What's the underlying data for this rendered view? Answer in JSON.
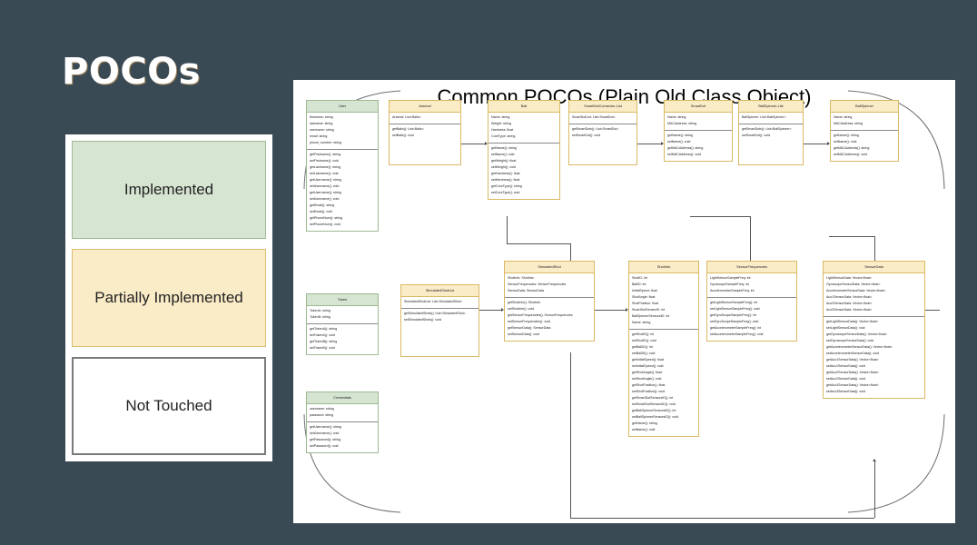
{
  "slide": {
    "title": "POCOs",
    "background_color": "#3a4a55"
  },
  "legend": {
    "items": [
      {
        "label": "Implemented",
        "color": "#d6e4d2",
        "border": "#9dba93"
      },
      {
        "label": "Partially Implemented",
        "color": "#fbecc8",
        "border": "#d9bd72"
      },
      {
        "label": "Not Touched",
        "color": "#ffffff",
        "border": "#7a7a7a"
      }
    ]
  },
  "diagram": {
    "title": "Common POCOs (Plain Old Class Object)",
    "classes": [
      {
        "id": "user",
        "name": "User",
        "status": "implemented",
        "attributes": [
          "firstname: string",
          "lastname: string",
          "username: string",
          "email: string",
          "phone_number: string"
        ],
        "methods": [
          "getFirstname(): string",
          "setFirstname(): void",
          "getLastname(): string",
          "setLastname(): void",
          "getUsername(): string",
          "setUsername(): void",
          "getUsername(): string",
          "setUsername(): void",
          "getEmail(): string",
          "setEmail(): void",
          "getPhoneNum(): string",
          "setPhoneNum(): void"
        ]
      },
      {
        "id": "token",
        "name": "Token",
        "status": "implemented",
        "attributes": [
          "TokenA: string",
          "TokenB: string"
        ],
        "methods": [
          "getTokenA(): string",
          "setTokenA(): void",
          "getTokenB(): string",
          "setTokenB(): void"
        ]
      },
      {
        "id": "credentials",
        "name": "Credentials",
        "status": "implemented",
        "attributes": [
          "username: string",
          "password: string"
        ],
        "methods": [
          "getUsername(): string",
          "setUsername(): void",
          "getPassword(): string",
          "setPassword(): void"
        ]
      },
      {
        "id": "arsenal",
        "name": "Arsenal",
        "status": "partial",
        "attributes": [
          "Arsenal: List<Balls>"
        ],
        "methods": [
          "getBalls(): List<Balls>",
          "setBalls(): void"
        ]
      },
      {
        "id": "ball",
        "name": "Ball",
        "status": "partial",
        "attributes": [
          "Name: string",
          "Weight: string",
          "Hardness: float",
          "CoreType: string"
        ],
        "methods": [
          "getName(): string",
          "setName(): void",
          "getWeight(): float",
          "setWeight(): void",
          "getHardness(): float",
          "setHardness(): float",
          "getCoreType(): string",
          "setCoreType(): void"
        ]
      },
      {
        "id": "smartdotconnector",
        "name": "SmartDotConnector-List",
        "status": "partial",
        "attributes": [
          "SmartDotList: List<SmartDot>"
        ],
        "methods": [
          "getSmartDots(): List<SmartDot>",
          "setSmartDot(): void"
        ]
      },
      {
        "id": "smartdot",
        "name": "SmartDot",
        "status": "partial",
        "attributes": [
          "Name: string",
          "MACAddress: string"
        ],
        "methods": [
          "getName(): string",
          "setName(): void",
          "getMACAddress(): string",
          "setMACAddress(): void"
        ]
      },
      {
        "id": "ballspinnerlist",
        "name": "BallSpinner-List",
        "status": "partial",
        "attributes": [
          "BallSpinner: List<BallSpinner>"
        ],
        "methods": [
          "getSmartDots(): List<BallSpinner>",
          "setSmartDot(): void"
        ]
      },
      {
        "id": "ballspinner",
        "name": "BallSpinner",
        "status": "partial",
        "attributes": [
          "Name: string",
          "MACAddress: string"
        ],
        "methods": [
          "getName(): string",
          "setName(): void",
          "getMACAddress(): string",
          "setMACAddress(): void"
        ]
      },
      {
        "id": "simulatedshotlist",
        "name": "SimulatedShotList",
        "status": "partial",
        "attributes": [
          "SimulatedShotList: List<SimulatedShot>"
        ],
        "methods": [
          "getSimulatedShots(): List<SimulatedShot>",
          "setSimulatedShots(): void"
        ]
      },
      {
        "id": "simulatedshot",
        "name": "SimulatedShot",
        "status": "partial",
        "attributes": [
          "ShotInfo: ShotInfo",
          "SensorFrequencies: SensorFrequencies",
          "SensorData: SensorData"
        ],
        "methods": [
          "getShotInfo(): ShotInfo",
          "setShotInfo(): void",
          "getSensorFrequencies(): SensorFrequencies",
          "setSensorFrequencies(): void",
          "getSensorData(): SensorData",
          "setSensorData(): void"
        ]
      },
      {
        "id": "shotinfo",
        "name": "ShotInfo",
        "status": "partial",
        "attributes": [
          "ShotID: int",
          "BallID: int",
          "InitialSpeed: float",
          "ShotAngle: float",
          "ShotPosition: float",
          "SmartDotSensorID: int",
          "BallSpinnerSensorsID: int",
          "Name: string"
        ],
        "methods": [
          "getShotID(): int",
          "setShotID(): void",
          "getBallID(): int",
          "setBallID(): void",
          "getInitialSpeed(): float",
          "setInitialSpeed(): void",
          "getShotAngle(): float",
          "setShotAngle(): void",
          "getShotPosition(): float",
          "setShotPosition(): void",
          "getSmartDotSensorsID(): int",
          "setSmartDotSensorsID(): void",
          "getBallSpinnerSensorsID(): int",
          "setBallSpinnerSensorsID(): void",
          "getName(): string",
          "setName(): void"
        ]
      },
      {
        "id": "sensorfrequencies",
        "name": "SensorFrequencies",
        "status": "partial",
        "attributes": [
          "LightSensorSampleFreq: int",
          "GyroscopeSampleFreq: int",
          "AccelerometerSampleFreq: int"
        ],
        "methods": [
          "getLightSensorSampleFreq(): int",
          "setLightSensorSampleFreq(): void",
          "getGyroScopeSampleFreq(): int",
          "setGyroScopeSampleFreq(): void",
          "getAccelerometerSampleFreq(): int",
          "setAccelerometerSampleFreq(): void"
        ]
      },
      {
        "id": "sensordata",
        "name": "SensorData",
        "status": "partial",
        "attributes": [
          "LightSensorData: Vector<float>",
          "GyroscopeSensorData: Vector<float>",
          "AccelerometerSensorData: Vector<float>",
          "Aux1SensorData: Vector<float>",
          "Aux2SensorData: Vector<float>",
          "Aux3SensorData: Vector<float>"
        ],
        "methods": [
          "getLightSensorData(): Vector<float>",
          "setLightSensorData(): void",
          "getGyroscopeSensorData(): Vector<float>",
          "setGyroscopeSensorData(): void",
          "getAccelerometerSensorData(): Vector<float>",
          "setAccelerometerSensorData(): void",
          "getAux1SensorData(): Vector<float>",
          "setAux1SensorData(): void",
          "getAux2SensorData(): Vector<float>",
          "setAux2SensorData(): void",
          "getAux3SensorData(): Vector<float>",
          "setAux3SensorData(): void"
        ]
      }
    ]
  }
}
